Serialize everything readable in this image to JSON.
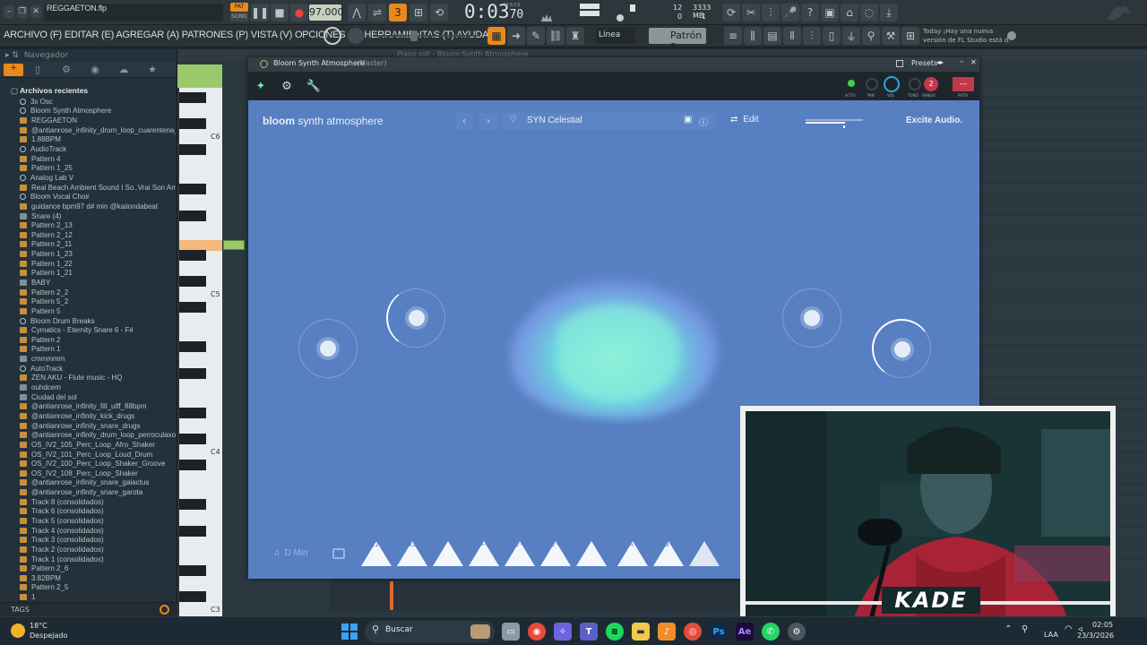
{
  "topbar": {
    "project_name": "REGGAETON.flp",
    "pat_label": "PAT",
    "song_label": "SONG",
    "tempo": "97.000",
    "time": "0:03",
    "time_frac": "70",
    "time_unit": "M:S:CS",
    "cpu_value": "12",
    "memory": "3333 MB",
    "memory_sub": "1",
    "poly": "0"
  },
  "menubar": {
    "menu_text": "ARCHIVO (F) EDITAR (E) AGREGAR (A) PATRONES (P) VISTA (V) OPCIONES (O) HERRAMIENTAS (T) AYUDA",
    "snap_mode": "Línea",
    "pattern": "Patrón 3",
    "news_line1": "Today ¡Hay una nueva",
    "news_line2": "versión de FL Studio está d."
  },
  "browser": {
    "title": "Navegador",
    "section": "Archivos recientes",
    "tags_label": "TAGS",
    "items": [
      {
        "label": "3x Osc",
        "icon": "plugin"
      },
      {
        "label": "Bloom Synth Atmosphere",
        "icon": "plugin"
      },
      {
        "label": "REGGAETON",
        "icon": "project"
      },
      {
        "label": "@antianrose_infinity_drum_loop_cuarentena_90bpm",
        "icon": "audio"
      },
      {
        "label": "1.88BPM",
        "icon": "audio"
      },
      {
        "label": "AudioTrack",
        "icon": "plugin"
      },
      {
        "label": "Pattern 4",
        "icon": "pattern"
      },
      {
        "label": "Pattern 1_25",
        "icon": "pattern"
      },
      {
        "label": "Analog Lab V",
        "icon": "plugin"
      },
      {
        "label": "Real Beach Ambient Sound I So..Vrai Son Ambiant de Plage",
        "icon": "audio"
      },
      {
        "label": "Bloom Vocal Choir",
        "icon": "plugin"
      },
      {
        "label": "guidance bpm97 d# min @kaiiondabeat",
        "icon": "audio"
      },
      {
        "label": "Snare (4)",
        "icon": "folder"
      },
      {
        "label": "Pattern 2_13",
        "icon": "pattern"
      },
      {
        "label": "Pattern 2_12",
        "icon": "pattern"
      },
      {
        "label": "Pattern 2_11",
        "icon": "pattern"
      },
      {
        "label": "Pattern 1_23",
        "icon": "pattern"
      },
      {
        "label": "Pattern 1_22",
        "icon": "pattern"
      },
      {
        "label": "Pattern 1_21",
        "icon": "pattern"
      },
      {
        "label": "BABY",
        "icon": "folder"
      },
      {
        "label": "Pattern 2_2",
        "icon": "pattern"
      },
      {
        "label": "Pattern 5_2",
        "icon": "pattern"
      },
      {
        "label": "Pattern 5",
        "icon": "pattern"
      },
      {
        "label": "Bloom Drum Breaks",
        "icon": "plugin"
      },
      {
        "label": "Cymatics - Eternity Snare 6 - F#",
        "icon": "audio"
      },
      {
        "label": "Pattern 2",
        "icon": "pattern"
      },
      {
        "label": "Pattern 1",
        "icon": "pattern"
      },
      {
        "label": "cmmmmm",
        "icon": "folder"
      },
      {
        "label": "AutoTrack",
        "icon": "plugin"
      },
      {
        "label": "ZEN AKU - Flute music - HQ",
        "icon": "audio"
      },
      {
        "label": "ouhdcem",
        "icon": "folder"
      },
      {
        "label": "Ciudad del sol",
        "icon": "folder"
      },
      {
        "label": "@antianrose_infinity_fill_ulff_88bpm",
        "icon": "audio"
      },
      {
        "label": "@antianrose_infinity_kick_drugs",
        "icon": "audio"
      },
      {
        "label": "@antianrose_infinity_snare_drugs",
        "icon": "audio"
      },
      {
        "label": "@antianrose_infinity_drum_loop_perroculaxo_91bpm",
        "icon": "audio"
      },
      {
        "label": "OS_IV2_105_Perc_Loop_Afro_Shaker",
        "icon": "audio"
      },
      {
        "label": "OS_IV2_101_Perc_Loop_Loud_Drum",
        "icon": "audio"
      },
      {
        "label": "OS_IV2_100_Perc_Loop_Shaker_Groove",
        "icon": "audio"
      },
      {
        "label": "OS_IV2_108_Perc_Loop_Shaker",
        "icon": "audio"
      },
      {
        "label": "@antianrose_infinity_snare_galactus",
        "icon": "audio"
      },
      {
        "label": "@antianrose_infinity_snare_garota",
        "icon": "audio"
      },
      {
        "label": "Track 8 (consolidados)",
        "icon": "pattern"
      },
      {
        "label": "Track 6 (consolidados)",
        "icon": "pattern"
      },
      {
        "label": "Track 5 (consolidados)",
        "icon": "pattern"
      },
      {
        "label": "Track 4 (consolidados)",
        "icon": "pattern"
      },
      {
        "label": "Track 3 (consolidados)",
        "icon": "pattern"
      },
      {
        "label": "Track 2 (consolidados)",
        "icon": "pattern"
      },
      {
        "label": "Track 1 (consolidados)",
        "icon": "pattern"
      },
      {
        "label": "Pattern 2_6",
        "icon": "pattern"
      },
      {
        "label": "3.82BPM",
        "icon": "audio"
      },
      {
        "label": "Pattern 2_5",
        "icon": "pattern"
      },
      {
        "label": "1",
        "icon": "pattern"
      }
    ]
  },
  "pianoroll": {
    "title": "Piano roll - Bloom Synth Atmosphere",
    "note_labels": [
      "C6",
      "C5",
      "C4",
      "C3"
    ]
  },
  "plugin": {
    "window_title": "Bloom Synth Atmosphere",
    "window_subtitle": "(Master)",
    "presets_label": "Presets",
    "knob_labels": [
      "ACTIV",
      "PAN",
      "VOL",
      "TONO",
      "RANGO",
      "PISTA"
    ],
    "rango_value": "2",
    "pista_value": "---",
    "brand_bold": "bloom",
    "brand_light": "synth atmosphere",
    "preset_name": "SYN Celestial",
    "edit_label": "Edit",
    "vendor": "Excite Audio.",
    "key_label": "D Min",
    "triangle_labels": [
      "/2",
      "x2",
      "",
      "←",
      "♪-",
      "♪+",
      "",
      "A",
      "B",
      ""
    ]
  },
  "webcam": {
    "overlay_text": "KADE"
  },
  "taskbar": {
    "temperature": "18°C",
    "weather": "Despejado",
    "search_placeholder": "Buscar",
    "lang": "LAA",
    "clock": "02:05",
    "date": "23/3/2026"
  },
  "colors": {
    "plugin_bg": "#577fc2",
    "accent_orange": "#e98a1c",
    "blob_teal": "#7fe3d6"
  }
}
